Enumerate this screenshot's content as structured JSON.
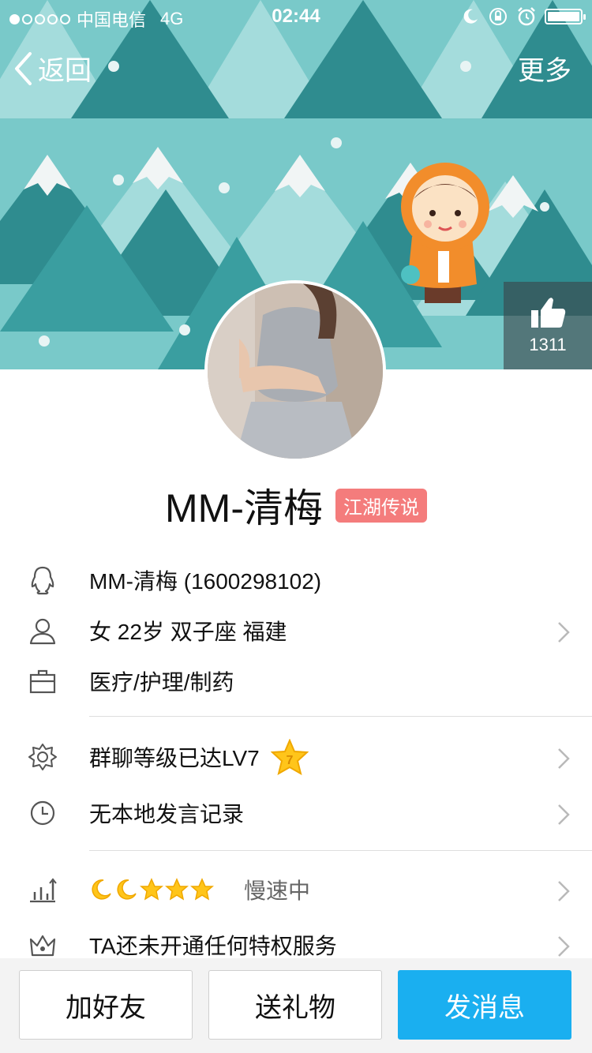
{
  "status_bar": {
    "carrier": "中国电信",
    "network": "4G",
    "time": "02:44"
  },
  "nav": {
    "back_label": "返回",
    "more_label": "更多"
  },
  "cover": {
    "like_count": "1311",
    "bg_color": "#79c9c9"
  },
  "profile": {
    "name": "MM-清梅",
    "title_badge": "江湖传说",
    "badge_color": "#f47c7c"
  },
  "info": {
    "qq": "MM-清梅 (1600298102)",
    "basic": "女 22岁 双子座 福建",
    "occupation": "医疗/护理/制药",
    "group_level": "群聊等级已达LV7",
    "speech_record": "无本地发言记录",
    "level_status": "慢速中",
    "privilege": "TA还未开通任何特权服务"
  },
  "actions": {
    "add_friend": "加好友",
    "send_gift": "送礼物",
    "send_message": "发消息",
    "primary_color": "#1aaff0"
  }
}
